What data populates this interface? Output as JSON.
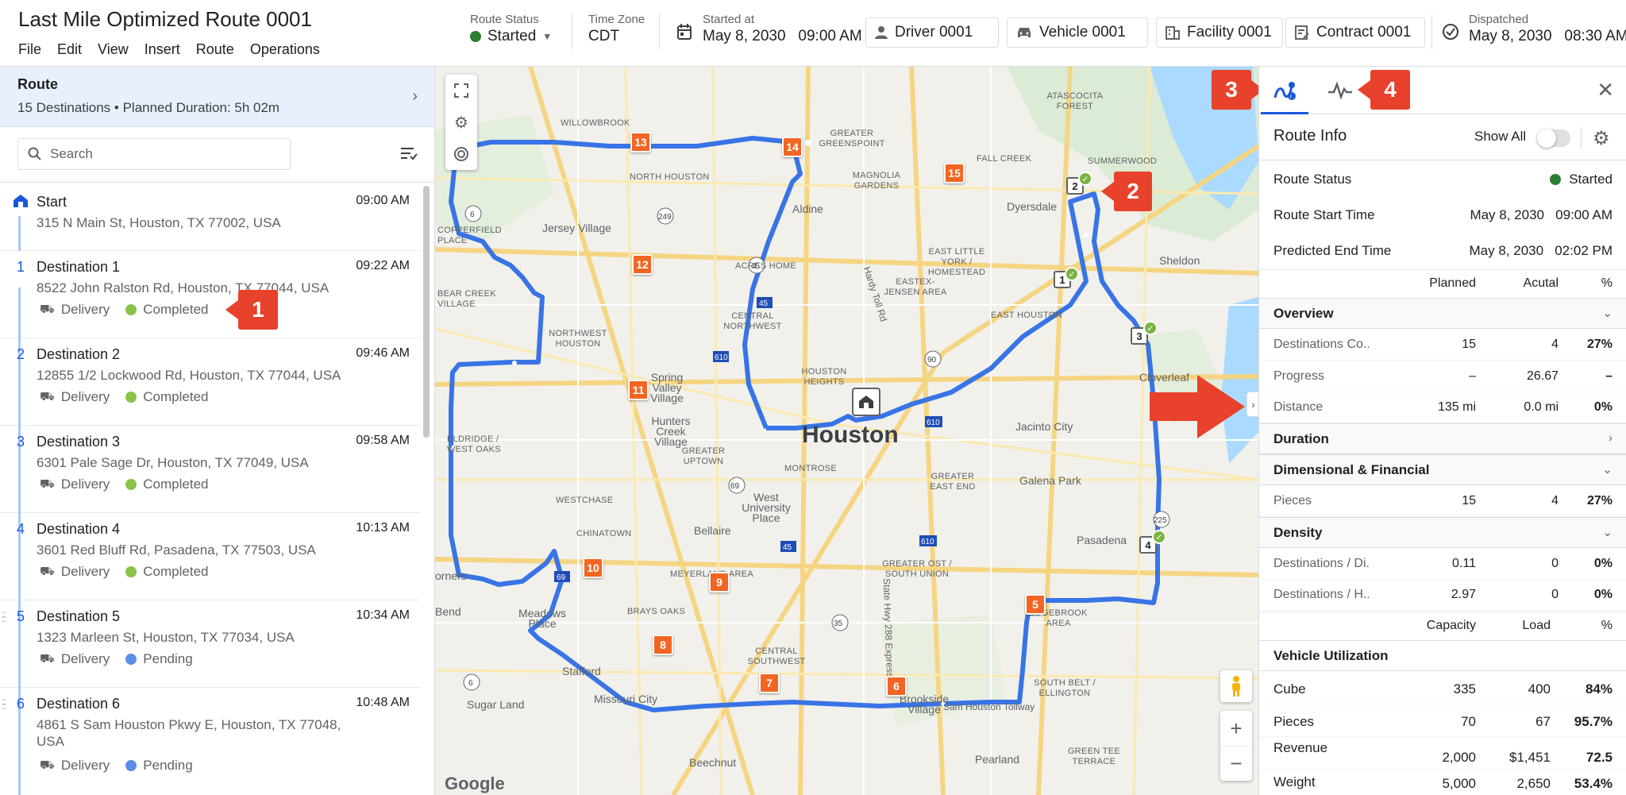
{
  "header": {
    "title": "Last Mile Optimized Route 0001",
    "menu": [
      "File",
      "Edit",
      "View",
      "Insert",
      "Route",
      "Operations"
    ],
    "route_status_label": "Route Status",
    "route_status_value": "Started",
    "time_zone_label": "Time Zone",
    "time_zone_value": "CDT",
    "started_at_label": "Started at",
    "started_at_value": "May 8, 2030   09:00 AM",
    "driver": "Driver 0001",
    "vehicle": "Vehicle 0001",
    "facility": "Facility 0001",
    "contract": "Contract 0001",
    "dispatched_label": "Dispatched",
    "dispatched_value": "May 8, 2030   08:30 AM",
    "status_color": "#2e7d32"
  },
  "left": {
    "route_title": "Route",
    "route_sub": "15 Destinations • Planned Duration: 5h 02m",
    "search_placeholder": "Search",
    "stops": [
      {
        "num": "",
        "name": "Start",
        "time": "09:00 AM",
        "addr": "315 N Main St, Houston, TX 77002, USA",
        "type": "",
        "status": ""
      },
      {
        "num": "1",
        "name": "Destination 1",
        "time": "09:22 AM",
        "addr": "8522 John Ralston Rd, Houston, TX 77044, USA",
        "type": "Delivery",
        "status": "Completed"
      },
      {
        "num": "2",
        "name": "Destination 2",
        "time": "09:46 AM",
        "addr": "12855 1/2 Lockwood Rd, Houston, TX 77044, USA",
        "type": "Delivery",
        "status": "Completed"
      },
      {
        "num": "3",
        "name": "Destination 3",
        "time": "09:58 AM",
        "addr": "6301 Pale Sage Dr, Houston, TX 77049, USA",
        "type": "Delivery",
        "status": "Completed"
      },
      {
        "num": "4",
        "name": "Destination 4",
        "time": "10:13 AM",
        "addr": "3601 Red Bluff Rd, Pasadena, TX 77503, USA",
        "type": "Delivery",
        "status": "Completed"
      },
      {
        "num": "5",
        "name": "Destination 5",
        "time": "10:34 AM",
        "addr": "1323 Marleen St, Houston, TX 77034, USA",
        "type": "Delivery",
        "status": "Pending"
      },
      {
        "num": "6",
        "name": "Destination 6",
        "time": "10:48 AM",
        "addr": "4861 S Sam Houston Pkwy E, Houston, TX 77048, USA",
        "type": "Delivery",
        "status": "Pending"
      }
    ],
    "completed_color": "#8bc34a",
    "pending_color": "#5c8ee6"
  },
  "map": {
    "city": "Houston",
    "places": [
      {
        "t": "WILLOWBROOK",
        "c": 1
      },
      {
        "t": "NORTH HOUSTON",
        "c": 1
      },
      {
        "t": "Jersey Village",
        "c": 0
      },
      {
        "t": "COPPERFIELD PLACE",
        "c": 1
      },
      {
        "t": "BEAR CREEK VILLAGE",
        "c": 1
      },
      {
        "t": "NORTHWEST HOUSTON",
        "c": 1
      },
      {
        "t": "Spring Valley Village",
        "c": 0
      },
      {
        "t": "Hunters Creek Village",
        "c": 0
      },
      {
        "t": "ELDRIDGE / WEST OAKS",
        "c": 1
      },
      {
        "t": "WESTCHASE",
        "c": 1
      },
      {
        "t": "CHINATOWN",
        "c": 1
      },
      {
        "t": "Meadows Place",
        "c": 0
      },
      {
        "t": "Stafford",
        "c": 0
      },
      {
        "t": "Sugar Land",
        "c": 0
      },
      {
        "t": "Missouri City",
        "c": 0
      },
      {
        "t": "BRAYS OAKS",
        "c": 1
      },
      {
        "t": "MEYERLAND AREA",
        "c": 1
      },
      {
        "t": "Bellaire",
        "c": 0
      },
      {
        "t": "West University Place",
        "c": 0
      },
      {
        "t": "CENTRAL SOUTHWEST",
        "c": 1
      },
      {
        "t": "GREATER UPTOWN",
        "c": 1
      },
      {
        "t": "HOUSTON HEIGHTS",
        "c": 1
      },
      {
        "t": "CENTRAL NORTHWEST",
        "c": 1
      },
      {
        "t": "ACRES HOME",
        "c": 1
      },
      {
        "t": "Aldine",
        "c": 0
      },
      {
        "t": "MAGNOLIA GARDENS",
        "c": 1
      },
      {
        "t": "GREATER GREENSPOINT",
        "c": 1
      },
      {
        "t": "EASTEX-JENSEN AREA",
        "c": 1
      },
      {
        "t": "EAST LITTLE YORK / HOMESTEAD",
        "c": 1
      },
      {
        "t": "EAST HOUSTON",
        "c": 1
      },
      {
        "t": "Dyersdale",
        "c": 0
      },
      {
        "t": "FALL CREEK",
        "c": 1
      },
      {
        "t": "ATASCOCITA FOREST",
        "c": 1
      },
      {
        "t": "SUMMERWOOD",
        "c": 1
      },
      {
        "t": "Sheldon",
        "c": 0
      },
      {
        "t": "Cloverleaf",
        "c": 0
      },
      {
        "t": "Jacinto City",
        "c": 0
      },
      {
        "t": "Galena Park",
        "c": 0
      },
      {
        "t": "Pasadena",
        "c": 0
      },
      {
        "t": "GREATER EAST END",
        "c": 1
      },
      {
        "t": "MONTROSE",
        "c": 1
      },
      {
        "t": "GREATER OST / SOUTH UNION",
        "c": 1
      },
      {
        "t": "SOUTH BELT / ELLINGTON",
        "c": 1
      },
      {
        "t": "EDGEBROOK AREA",
        "c": 1
      },
      {
        "t": "Brookside Village",
        "c": 0
      },
      {
        "t": "Pearland",
        "c": 0
      },
      {
        "t": "GREEN TEE TERRACE",
        "c": 1
      },
      {
        "t": "Beechnut",
        "c": 0
      },
      {
        "t": "Bend",
        "c": 0
      },
      {
        "t": "orners",
        "c": 0
      },
      {
        "t": "Hardy Toll Rd",
        "c": 0
      },
      {
        "t": "State Hwy 288 Express",
        "c": 0
      },
      {
        "t": "Sam Houston Tollway",
        "c": 0
      }
    ],
    "orange_stops": [
      "5",
      "6",
      "7",
      "8",
      "9",
      "10",
      "11",
      "12",
      "13",
      "14",
      "15"
    ],
    "white_stops": [
      "1",
      "2",
      "3",
      "4"
    ],
    "google": "Google",
    "route_color": "#3874e6",
    "stop_color": "#f26522"
  },
  "callouts": [
    "1",
    "2",
    "3",
    "4"
  ],
  "right": {
    "title": "Route Info",
    "show_all": "Show All",
    "status_label": "Route Status",
    "status_value": "Started",
    "start_label": "Route Start Time",
    "start_value": "May 8, 2030   09:00 AM",
    "end_label": "Predicted End Time",
    "end_value": "May 8, 2030   02:02 PM",
    "cols": {
      "planned": "Planned",
      "actual": "Acutal",
      "pct": "%"
    },
    "overview": {
      "title": "Overview",
      "rows": [
        {
          "label": "Destinations Co...",
          "a": "15",
          "b": "4",
          "c": "27%"
        },
        {
          "label": "Progress",
          "a": "–",
          "b": "26.67",
          "c": "–"
        },
        {
          "label": "Distance",
          "a": "135 mi",
          "b": "0.0 mi",
          "c": "0%"
        }
      ]
    },
    "duration": "Duration",
    "dimfin": {
      "title": "Dimensional & Financial",
      "rows": [
        {
          "label": "Pieces",
          "a": "15",
          "b": "4",
          "c": "27%"
        }
      ]
    },
    "density": {
      "title": "Density",
      "rows": [
        {
          "label": "Destinations / Di...",
          "a": "0.11",
          "b": "0",
          "c": "0%"
        },
        {
          "label": "Destinations / H...",
          "a": "2.97",
          "b": "0",
          "c": "0%"
        }
      ]
    },
    "cols2": {
      "capacity": "Capacity",
      "load": "Load",
      "pct": "%"
    },
    "vehicle": {
      "title": "Vehicle Utilization",
      "rows": [
        {
          "label": "Cube",
          "a": "335",
          "b": "400",
          "c": "84%"
        },
        {
          "label": "Pieces",
          "a": "70",
          "b": "67",
          "c": "95.7%"
        },
        {
          "label": "Revenue",
          "a": "2,000",
          "b": "$1,451",
          "c": "72.5"
        },
        {
          "label": "Weight",
          "a": "5,000",
          "b": "2,650",
          "c": "53.4%"
        }
      ]
    }
  }
}
